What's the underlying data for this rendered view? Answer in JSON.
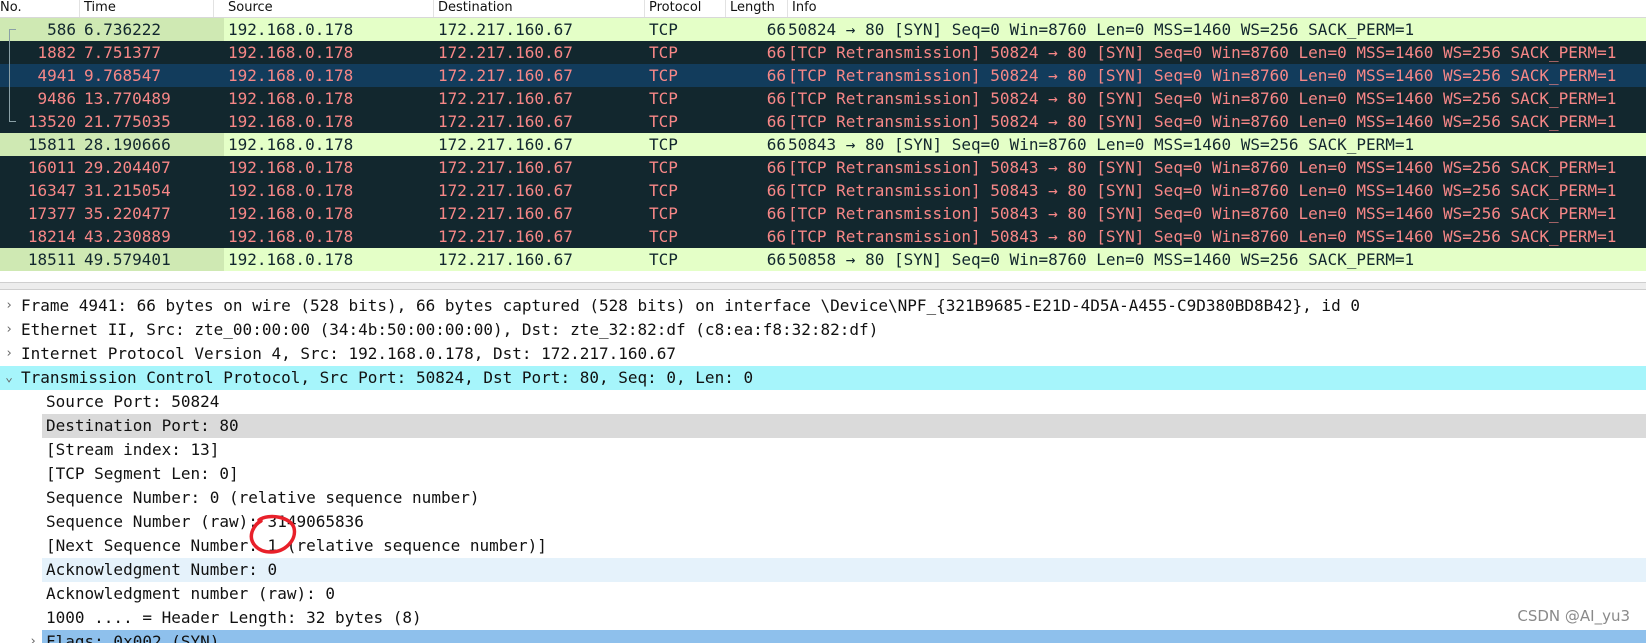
{
  "packet_list": {
    "columns": [
      "No.",
      "Time",
      "Source",
      "Destination",
      "Protocol",
      "Length",
      "Info"
    ],
    "rows": [
      {
        "no": "586",
        "time": "6.736222",
        "src": "192.168.0.178",
        "dst": "172.217.160.67",
        "proto": "TCP",
        "len": "66",
        "info": "50824 → 80 [SYN] Seq=0 Win=8760 Len=0 MSS=1460 WS=256 SACK_PERM=1",
        "style": "syn"
      },
      {
        "no": "1882",
        "time": "7.751377",
        "src": "192.168.0.178",
        "dst": "172.217.160.67",
        "proto": "TCP",
        "len": "66",
        "info": "[TCP Retransmission] 50824 → 80 [SYN] Seq=0 Win=8760 Len=0 MSS=1460 WS=256 SACK_PERM=1",
        "style": "retrans"
      },
      {
        "no": "4941",
        "time": "9.768547",
        "src": "192.168.0.178",
        "dst": "172.217.160.67",
        "proto": "TCP",
        "len": "66",
        "info": "[TCP Retransmission] 50824 → 80 [SYN] Seq=0 Win=8760 Len=0 MSS=1460 WS=256 SACK_PERM=1",
        "style": "selected"
      },
      {
        "no": "9486",
        "time": "13.770489",
        "src": "192.168.0.178",
        "dst": "172.217.160.67",
        "proto": "TCP",
        "len": "66",
        "info": "[TCP Retransmission] 50824 → 80 [SYN] Seq=0 Win=8760 Len=0 MSS=1460 WS=256 SACK_PERM=1",
        "style": "retrans"
      },
      {
        "no": "13520",
        "time": "21.775035",
        "src": "192.168.0.178",
        "dst": "172.217.160.67",
        "proto": "TCP",
        "len": "66",
        "info": "[TCP Retransmission] 50824 → 80 [SYN] Seq=0 Win=8760 Len=0 MSS=1460 WS=256 SACK_PERM=1",
        "style": "retrans"
      },
      {
        "no": "15811",
        "time": "28.190666",
        "src": "192.168.0.178",
        "dst": "172.217.160.67",
        "proto": "TCP",
        "len": "66",
        "info": "50843 → 80 [SYN] Seq=0 Win=8760 Len=0 MSS=1460 WS=256 SACK_PERM=1",
        "style": "syn"
      },
      {
        "no": "16011",
        "time": "29.204407",
        "src": "192.168.0.178",
        "dst": "172.217.160.67",
        "proto": "TCP",
        "len": "66",
        "info": "[TCP Retransmission] 50843 → 80 [SYN] Seq=0 Win=8760 Len=0 MSS=1460 WS=256 SACK_PERM=1",
        "style": "retrans"
      },
      {
        "no": "16347",
        "time": "31.215054",
        "src": "192.168.0.178",
        "dst": "172.217.160.67",
        "proto": "TCP",
        "len": "66",
        "info": "[TCP Retransmission] 50843 → 80 [SYN] Seq=0 Win=8760 Len=0 MSS=1460 WS=256 SACK_PERM=1",
        "style": "retrans"
      },
      {
        "no": "17377",
        "time": "35.220477",
        "src": "192.168.0.178",
        "dst": "172.217.160.67",
        "proto": "TCP",
        "len": "66",
        "info": "[TCP Retransmission] 50843 → 80 [SYN] Seq=0 Win=8760 Len=0 MSS=1460 WS=256 SACK_PERM=1",
        "style": "retrans"
      },
      {
        "no": "18214",
        "time": "43.230889",
        "src": "192.168.0.178",
        "dst": "172.217.160.67",
        "proto": "TCP",
        "len": "66",
        "info": "[TCP Retransmission] 50843 → 80 [SYN] Seq=0 Win=8760 Len=0 MSS=1460 WS=256 SACK_PERM=1",
        "style": "retrans"
      },
      {
        "no": "18511",
        "time": "49.579401",
        "src": "192.168.0.178",
        "dst": "172.217.160.67",
        "proto": "TCP",
        "len": "66",
        "info": "50858 → 80 [SYN] Seq=0 Win=8760 Len=0 MSS=1460 WS=256 SACK_PERM=1",
        "style": "syn"
      }
    ]
  },
  "details": {
    "rows": [
      {
        "text": "Frame 4941: 66 bytes on wire (528 bits), 66 bytes captured (528 bits) on interface \\Device\\NPF_{321B9685-E21D-4D5A-A455-C9D380BD8B42}, id 0",
        "level": 0,
        "arrow": "›",
        "style": ""
      },
      {
        "text": "Ethernet II, Src: zte_00:00:00 (34:4b:50:00:00:00), Dst: zte_32:82:df (c8:ea:f8:32:82:df)",
        "level": 0,
        "arrow": "›",
        "style": ""
      },
      {
        "text": "Internet Protocol Version 4, Src: 192.168.0.178, Dst: 172.217.160.67",
        "level": 0,
        "arrow": "›",
        "style": ""
      },
      {
        "text": "Transmission Control Protocol, Src Port: 50824, Dst Port: 80, Seq: 0, Len: 0",
        "level": 0,
        "arrow": "⌄",
        "style": "cyan"
      },
      {
        "text": "Source Port: 50824",
        "level": 1,
        "arrow": "",
        "style": ""
      },
      {
        "text": "Destination Port: 80",
        "level": 1,
        "arrow": "",
        "style": "gray"
      },
      {
        "text": "[Stream index: 13]",
        "level": 1,
        "arrow": "",
        "style": ""
      },
      {
        "text": "[TCP Segment Len: 0]",
        "level": 1,
        "arrow": "",
        "style": ""
      },
      {
        "text": "Sequence Number: 0    (relative sequence number)",
        "level": 1,
        "arrow": "",
        "style": ""
      },
      {
        "text": "Sequence Number (raw): 3149065836",
        "level": 1,
        "arrow": "",
        "style": ""
      },
      {
        "text": "[Next Sequence Number: 1    (relative sequence number)]",
        "level": 1,
        "arrow": "",
        "style": ""
      },
      {
        "text": "Acknowledgment Number: 0",
        "level": 1,
        "arrow": "",
        "style": "pale"
      },
      {
        "text": "Acknowledgment number (raw): 0",
        "level": 1,
        "arrow": "",
        "style": ""
      },
      {
        "text": "1000 .... = Header Length: 32 bytes (8)",
        "level": 1,
        "arrow": "",
        "style": ""
      },
      {
        "text": "Flags: 0x002 (SYN)",
        "level": 1,
        "arrow": "›",
        "style": "blue"
      }
    ]
  },
  "watermark": "CSDN @AI_yu3",
  "colors": {
    "syn_bg": "#e4ffc7",
    "retrans_bg": "#12272e",
    "retrans_fg": "#f78787",
    "selected_bg": "#123c5c",
    "cyan_highlight": "#a6f5fb",
    "annotation_red": "#e8202a"
  }
}
